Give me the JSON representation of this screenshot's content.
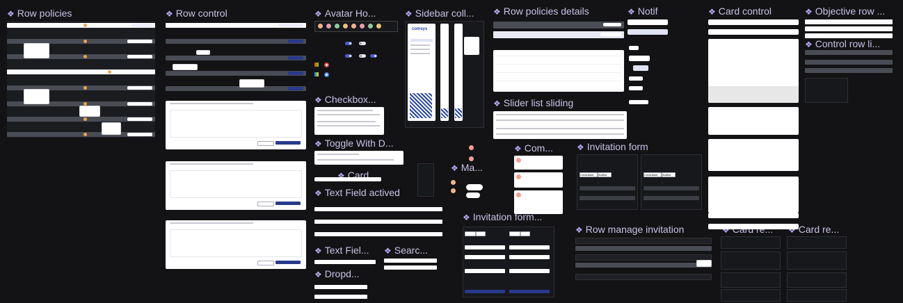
{
  "sections": {
    "row_policies": "Row policies",
    "row_control": "Row control",
    "avatar_ho": "Avatar Ho...",
    "sidebar_coll": "Sidebar coll...",
    "row_policies_details": "Row policies details",
    "notif": "Notif",
    "card_control": "Card control",
    "objective_row": "Objective row ...",
    "control_row": "Control row li...",
    "checkbox": "Checkbox...",
    "toggle_with_d": "Toggle With D...",
    "card": "Card",
    "ma": "Ma...",
    "text_field_actived": "Text Field actived",
    "text_fiel": "Text Fiel...",
    "searc": "Searc...",
    "dropd": "Dropd...",
    "slider_list_sliding": "Slider list sliding",
    "com": "Com...",
    "invitation_form": "Invitation form",
    "invitation_form2": "Invitation form...",
    "row_manage_invitation": "Row manage invitation",
    "card_re1": "Card re...",
    "card_re2": "Card re..."
  },
  "sidebar": {
    "brand": "comsys"
  },
  "invitation": {
    "consultant": "Consultant",
    "auditor": "Auditor"
  },
  "colors": {
    "background": "#131315",
    "title": "#c9c2e6",
    "accent": "#283a8c"
  }
}
